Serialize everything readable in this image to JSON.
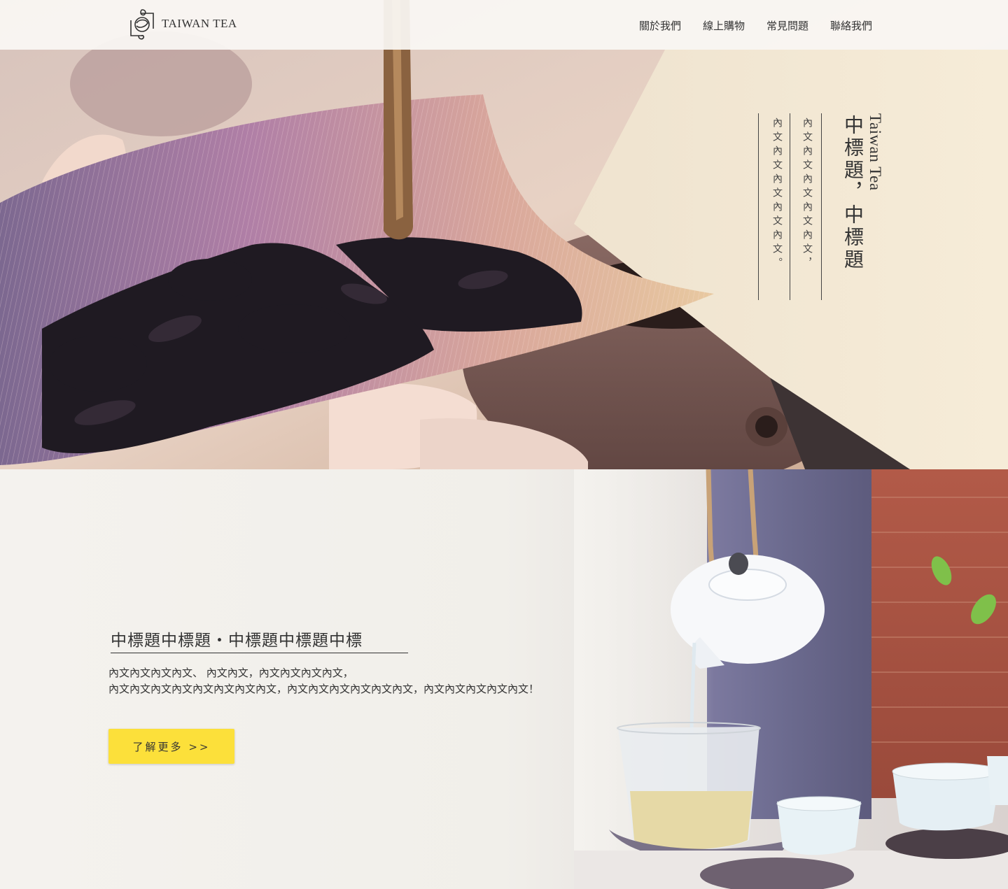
{
  "header": {
    "logo_text": "TAIWAN TEA",
    "nav": [
      "關於我們",
      "線上購物",
      "常見問題",
      "聯絡我們"
    ]
  },
  "hero": {
    "title_en": "Taiwan Tea",
    "title_zh": "中標題，中標題",
    "body_line1": "內文內文內文內文內文，",
    "body_line2": "內文內文內文內文內文。"
  },
  "section2": {
    "title": "中標題中標題・中標題中標題中標",
    "body_line1": "內文內文內文內文、 內文內文，內文內文內文內文，",
    "body_line2": "內文內文內文內文內文內文內文內文，內文內文內文內文內文內文，內文內文內文內文內文！",
    "button_label": "了解更多  >>"
  },
  "colors": {
    "accent_button": "#fce03a",
    "header_bg": "#faf8f4",
    "text": "#333333"
  }
}
